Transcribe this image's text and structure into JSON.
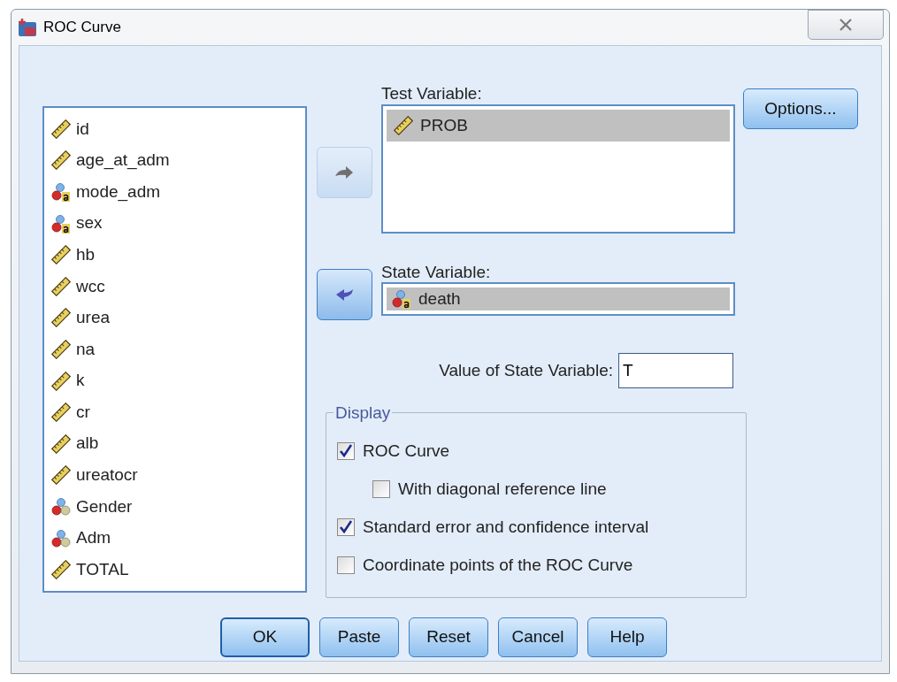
{
  "window": {
    "title": "ROC Curve"
  },
  "source_variables": [
    {
      "name": "id",
      "kind": "scale"
    },
    {
      "name": "age_at_adm",
      "kind": "scale"
    },
    {
      "name": "mode_adm",
      "kind": "nominal_string"
    },
    {
      "name": "sex",
      "kind": "nominal_string"
    },
    {
      "name": "hb",
      "kind": "scale"
    },
    {
      "name": "wcc",
      "kind": "scale"
    },
    {
      "name": "urea",
      "kind": "scale"
    },
    {
      "name": "na",
      "kind": "scale"
    },
    {
      "name": "k",
      "kind": "scale"
    },
    {
      "name": "cr",
      "kind": "scale"
    },
    {
      "name": "alb",
      "kind": "scale"
    },
    {
      "name": "ureatocr",
      "kind": "scale"
    },
    {
      "name": "Gender",
      "kind": "nominal"
    },
    {
      "name": "Adm",
      "kind": "nominal"
    },
    {
      "name": "TOTAL",
      "kind": "scale"
    }
  ],
  "move_buttons": [
    {
      "kind": "right",
      "disabled": true
    },
    {
      "kind": "left",
      "disabled": false
    }
  ],
  "test_variable": {
    "label": "Test Variable:",
    "items": [
      {
        "name": "PROB",
        "kind": "scale",
        "selected": true
      }
    ]
  },
  "state_variable": {
    "label": "State Variable:",
    "item": {
      "name": "death",
      "kind": "nominal_string",
      "selected": true
    }
  },
  "state_value": {
    "label": "Value of State Variable:",
    "value": "T"
  },
  "options_button": "Options...",
  "display": {
    "title": "Display",
    "options": [
      {
        "label": "ROC Curve",
        "checked": true,
        "indented": false
      },
      {
        "label": "With diagonal reference line",
        "checked": false,
        "indented": true
      },
      {
        "label": "Standard error and confidence interval",
        "checked": true,
        "indented": false
      },
      {
        "label": "Coordinate points of the ROC Curve",
        "checked": false,
        "indented": false
      }
    ]
  },
  "buttons": [
    {
      "label": "OK",
      "default": true
    },
    {
      "label": "Paste",
      "default": false
    },
    {
      "label": "Reset",
      "default": false
    },
    {
      "label": "Cancel",
      "default": false
    },
    {
      "label": "Help",
      "default": false
    }
  ]
}
